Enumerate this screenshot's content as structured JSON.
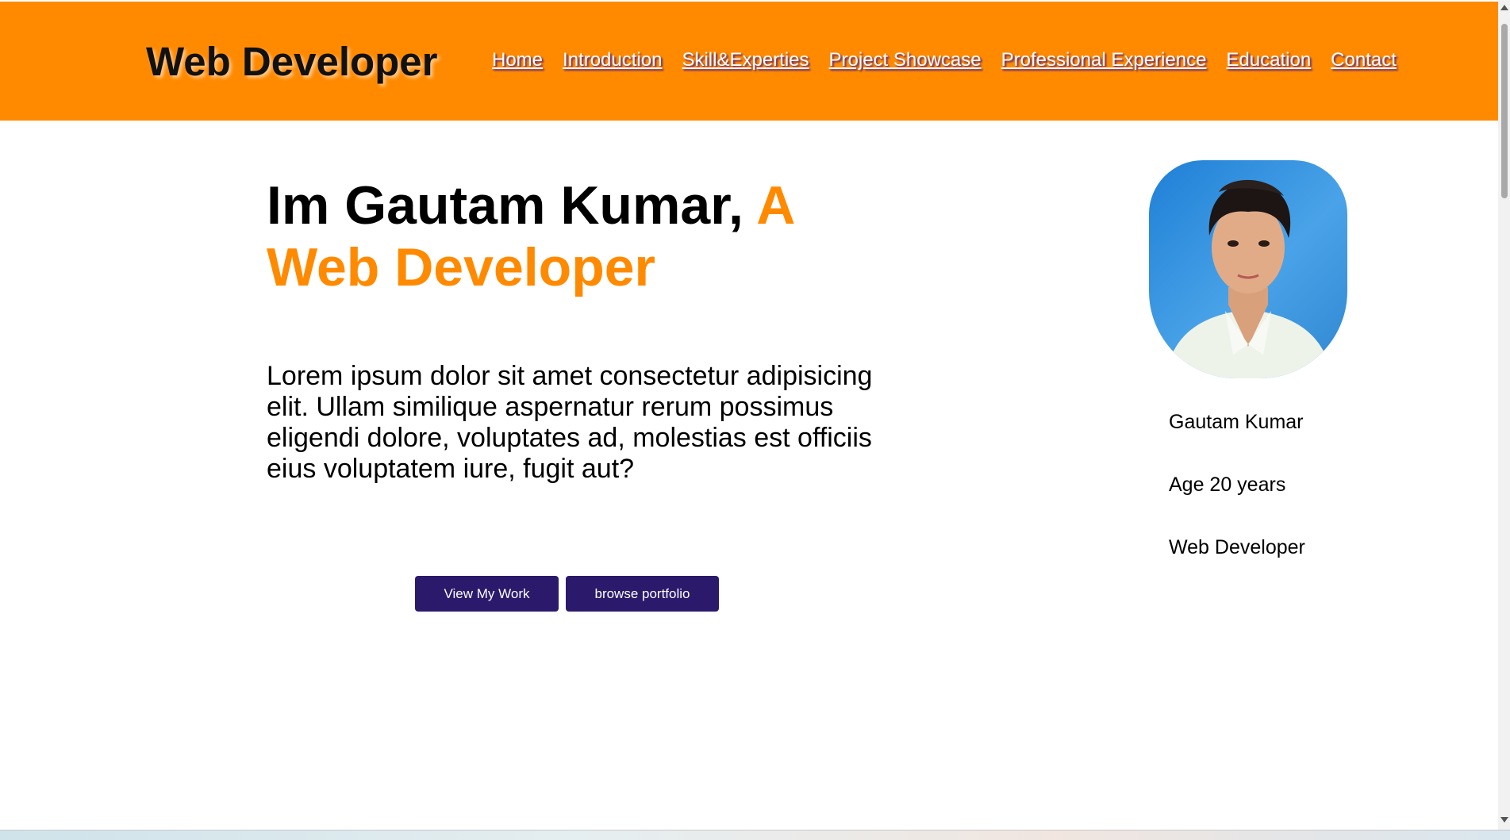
{
  "header": {
    "brand": "Web Developer",
    "nav": [
      "Home",
      "Introduction",
      "Skill&Experties",
      "Project Showcase",
      "Professional Experience",
      "Education",
      "Contact"
    ]
  },
  "hero": {
    "title_main": "Im Gautam Kumar, ",
    "title_accent": "A Web Developer",
    "description": "Lorem ipsum dolor sit amet consectetur adipisicing elit. Ullam similique aspernatur rerum possimus eligendi dolore, voluptates ad, molestias est officiis eius voluptatem iure, fugit aut?",
    "buttons": {
      "view_work": "View My Work",
      "browse_portfolio": "browse portfolio"
    }
  },
  "profile": {
    "name": "Gautam Kumar",
    "age": "Age 20 years",
    "role": "Web Developer"
  },
  "colors": {
    "header_bg": "#ff8a00",
    "accent": "#ff8a00",
    "button_bg": "#2b1a6b"
  }
}
